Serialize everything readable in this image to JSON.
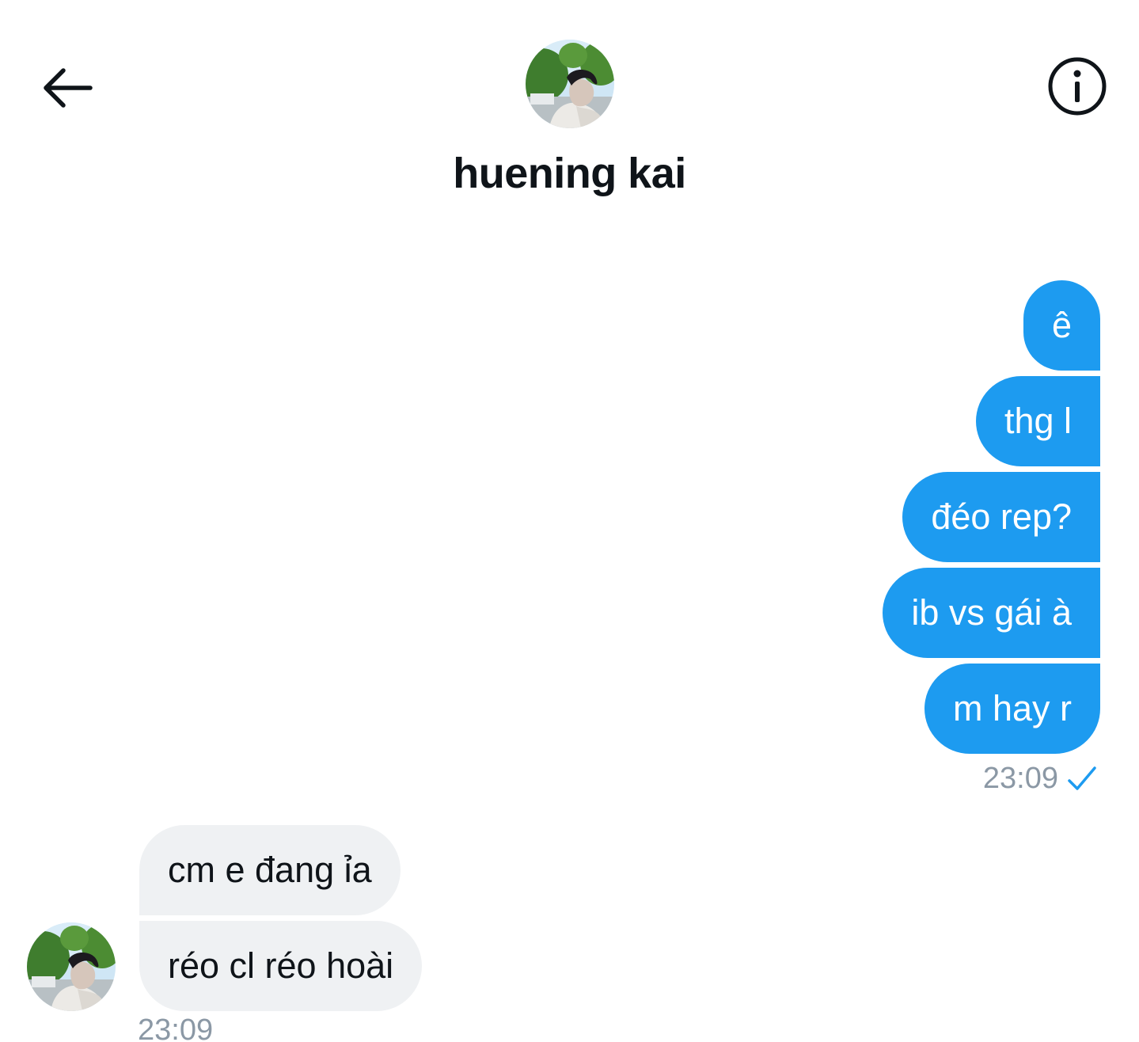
{
  "header": {
    "back_icon": "arrow-left-icon",
    "title": "huening kai",
    "info_icon": "info-icon",
    "avatar_icon": "profile-photo"
  },
  "colors": {
    "sent_bubble": "#1d9bf0",
    "received_bubble": "#eff1f3",
    "timestamp": "#8b98a5",
    "read_check": "#1d9bf0"
  },
  "sent": {
    "messages": [
      "ê",
      "thg l",
      "đéo rep?",
      "ib vs gái à",
      "m hay r"
    ],
    "time": "23:09",
    "status_icon": "check-icon"
  },
  "received": {
    "messages": [
      "cm e đang ỉa",
      "réo cl réo hoài"
    ],
    "time": "23:09"
  }
}
